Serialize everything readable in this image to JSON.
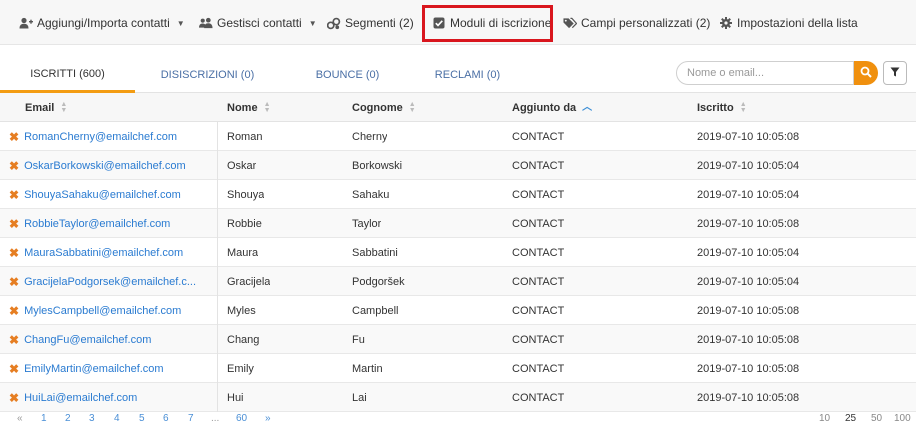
{
  "toolbar": {
    "items": [
      {
        "label": "Aggiungi/Importa contatti",
        "icon": "user-plus-icon",
        "dropdown": true
      },
      {
        "label": "Gestisci contatti",
        "icon": "users-icon",
        "dropdown": true
      },
      {
        "label": "Segmenti (2)",
        "icon": "segments-icon",
        "dropdown": false
      },
      {
        "label": "Moduli di iscrizione",
        "icon": "checkbox-icon",
        "dropdown": false
      },
      {
        "label": "Campi personalizzati (2)",
        "icon": "tags-icon",
        "dropdown": false
      },
      {
        "label": "Impostazioni della lista",
        "icon": "gear-icon",
        "dropdown": false
      }
    ],
    "highlight_color": "#d9161e"
  },
  "tabs": [
    {
      "label": "ISCRITTI (600)",
      "active": true
    },
    {
      "label": "DISISCRIZIONI (0)",
      "active": false
    },
    {
      "label": "BOUNCE (0)",
      "active": false
    },
    {
      "label": "RECLAMI (0)",
      "active": false
    }
  ],
  "search": {
    "placeholder": "Nome o email...",
    "value": ""
  },
  "accent_color": "#f0900e",
  "table": {
    "columns": [
      "Email",
      "Nome",
      "Cognome",
      "Aggiunto da",
      "Iscritto"
    ],
    "sorted_column": "Aggiunto da",
    "rows": [
      {
        "email": "RomanCherny@emailchef.com",
        "nome": "Roman",
        "cognome": "Cherny",
        "aggiunto": "CONTACT",
        "iscritto": "2019-07-10 10:05:08"
      },
      {
        "email": "OskarBorkowski@emailchef.com",
        "nome": "Oskar",
        "cognome": "Borkowski",
        "aggiunto": "CONTACT",
        "iscritto": "2019-07-10 10:05:04"
      },
      {
        "email": "ShouyaSahaku@emailchef.com",
        "nome": "Shouya",
        "cognome": "Sahaku",
        "aggiunto": "CONTACT",
        "iscritto": "2019-07-10 10:05:04"
      },
      {
        "email": "RobbieTaylor@emailchef.com",
        "nome": "Robbie",
        "cognome": "Taylor",
        "aggiunto": "CONTACT",
        "iscritto": "2019-07-10 10:05:08"
      },
      {
        "email": "MauraSabbatini@emailchef.com",
        "nome": "Maura",
        "cognome": "Sabbatini",
        "aggiunto": "CONTACT",
        "iscritto": "2019-07-10 10:05:04"
      },
      {
        "email": "GracijelaPodgorsek@emailchef.c...",
        "nome": "Gracijela",
        "cognome": "Podgoršek",
        "aggiunto": "CONTACT",
        "iscritto": "2019-07-10 10:05:04"
      },
      {
        "email": "MylesCampbell@emailchef.com",
        "nome": "Myles",
        "cognome": "Campbell",
        "aggiunto": "CONTACT",
        "iscritto": "2019-07-10 10:05:08"
      },
      {
        "email": "ChangFu@emailchef.com",
        "nome": "Chang",
        "cognome": "Fu",
        "aggiunto": "CONTACT",
        "iscritto": "2019-07-10 10:05:08"
      },
      {
        "email": "EmilyMartin@emailchef.com",
        "nome": "Emily",
        "cognome": "Martin",
        "aggiunto": "CONTACT",
        "iscritto": "2019-07-10 10:05:08"
      },
      {
        "email": "HuiLai@emailchef.com",
        "nome": "Hui",
        "cognome": "Lai",
        "aggiunto": "CONTACT",
        "iscritto": "2019-07-10 10:05:08"
      }
    ]
  },
  "pagination": {
    "prev": "«",
    "pages": [
      "1",
      "2",
      "3",
      "4",
      "5",
      "6",
      "7"
    ],
    "ellipsis": "...",
    "last": "60",
    "next": "»",
    "per_page": [
      "10",
      "25",
      "50",
      "100"
    ],
    "current_per_page": "25"
  }
}
